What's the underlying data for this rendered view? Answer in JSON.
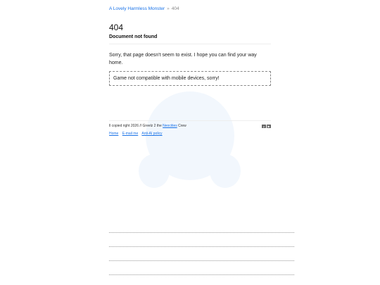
{
  "breadcrumb": {
    "home_label": "A Lovely Harmless Monster",
    "separator": "»",
    "current": "404"
  },
  "error": {
    "code": "404",
    "title": "Document not found",
    "message": "Sorry, that page doesn't seem to exist. I hope you can find your way home."
  },
  "notice": {
    "text": "Game not compatible with mobile devices, sorry!"
  },
  "footer": {
    "copyright_prefix": "ll copied right 2026 // Greelz 2 the ",
    "neocities_link": "Neocities",
    "copyright_suffix": " Crew",
    "badge_1": "p",
    "badge_2": "▶",
    "links": [
      {
        "label": "Home"
      },
      {
        "label": "E-mail me"
      },
      {
        "label": "Anti-AI policy"
      }
    ]
  },
  "colors": {
    "link": "#1a73e8",
    "blob": "#f2f7fd"
  }
}
